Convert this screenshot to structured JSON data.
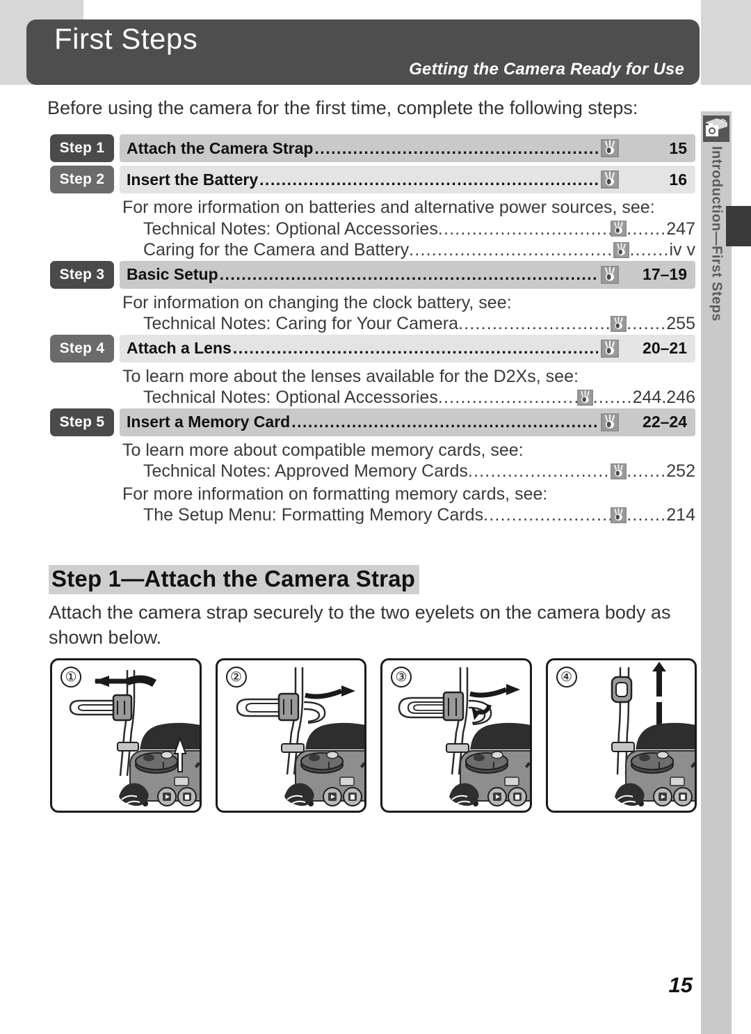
{
  "header": {
    "title": "First Steps",
    "subtitle": "Getting the Camera Ready for Use"
  },
  "side_tab": {
    "label": "Introduction—First Steps",
    "icon": "camera-in-hand-icon"
  },
  "intro": "Before using the camera for the first time, complete the following steps:",
  "icons": {
    "reference": "reference-eye-icon"
  },
  "dots": "..........................................................................................................",
  "steps": [
    {
      "badge": "Step 1",
      "title": "Attach the Camera Strap",
      "page": "15",
      "shade": "dark",
      "badge_shade": "dark",
      "notes": []
    },
    {
      "badge": "Step 2",
      "title": "Insert the Battery",
      "page": "16",
      "shade": "light",
      "badge_shade": "light",
      "notes": [
        {
          "lead": "For more irformation on batteries and alternative power sources, see:",
          "refs": [
            {
              "title": "Technical Notes: Optional Accessories",
              "page": "247"
            },
            {
              "title": "Caring for the Camera and Battery ",
              "page": "iv v"
            }
          ]
        }
      ]
    },
    {
      "badge": "Step 3",
      "title": "Basic Setup",
      "page": "17–19",
      "shade": "dark",
      "badge_shade": "dark",
      "notes": [
        {
          "lead": "For information on changing the clock battery, see:",
          "refs": [
            {
              "title": "Technical Notes: Caring for Your Camera ",
              "page": "255"
            }
          ]
        }
      ]
    },
    {
      "badge": "Step 4",
      "title": "Attach a Lens",
      "page": "20–21",
      "shade": "light",
      "badge_shade": "light",
      "notes": [
        {
          "lead": "To learn more about the lenses available for the D2Xs, see:",
          "refs": [
            {
              "title": "Technical Notes: Optional Accessories",
              "page": "244.246"
            }
          ]
        }
      ]
    },
    {
      "badge": "Step 5",
      "title": "Insert a Memory Card",
      "page": "22–24",
      "shade": "dark",
      "badge_shade": "dark",
      "notes": [
        {
          "lead": "To learn more about compatible memory cards, see:",
          "refs": [
            {
              "title": "Technical Notes: Approved Memory Cards ",
              "page": "252"
            }
          ]
        },
        {
          "lead": "For more information on formatting memory cards, see:",
          "refs": [
            {
              "title": "The Setup Menu: Formatting Memory Cards",
              "page": "214"
            }
          ]
        }
      ]
    }
  ],
  "section": {
    "heading": "Step 1—Attach the Camera Strap",
    "body": "Attach the camera strap securely to the two eyelets on the camera body as shown below."
  },
  "panels": [
    {
      "number": "①",
      "caption": "strap-threading-step-1"
    },
    {
      "number": "②",
      "caption": "strap-threading-step-2"
    },
    {
      "number": "③",
      "caption": "strap-threading-step-3"
    },
    {
      "number": "④",
      "caption": "strap-threading-step-4"
    }
  ],
  "folio": "15"
}
